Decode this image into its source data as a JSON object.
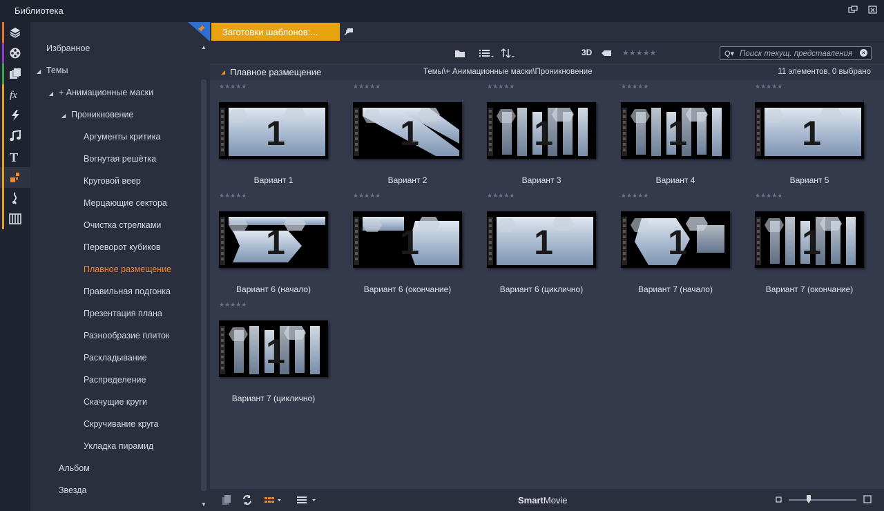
{
  "window": {
    "title": "Библиотека"
  },
  "sidebar_icons": [
    {
      "name": "project-bin-icon",
      "color": "#e8742a"
    },
    {
      "name": "film-reel-icon",
      "color": "#8a3fc9"
    },
    {
      "name": "photos-icon",
      "color": "#3aa84a"
    },
    {
      "name": "effects-fx-icon",
      "color": "#e0a020"
    },
    {
      "name": "transitions-icon",
      "color": "#e0a020"
    },
    {
      "name": "music-note-icon",
      "color": "#e0a020"
    },
    {
      "name": "titles-text-icon",
      "color": "#e0a020"
    },
    {
      "name": "montage-templates-icon",
      "color": "#e0a020"
    },
    {
      "name": "sound-effects-icon",
      "color": "#e0a020"
    },
    {
      "name": "keyboard-icon",
      "color": "#e0a020"
    }
  ],
  "tree": {
    "favorites": "Избранное",
    "themes": "Темы",
    "animated_masks": "+ Анимационные маски",
    "penetration": "Проникновение",
    "items": [
      "Аргументы критика",
      "Вогнутая решётка",
      "Круговой веер",
      "Мерцающие сектора",
      "Очистка стрелками",
      "Переворот кубиков",
      "Плавное размещение",
      "Правильная подгонка",
      "Презентация плана",
      "Разнообразие плиток",
      "Раскладывание",
      "Распределение",
      "Скачущие круги",
      "Скручивание круга",
      "Укладка пирамид"
    ],
    "selected_index": 6,
    "album": "Альбом",
    "star": "Звезда"
  },
  "tabs": {
    "active_label": "Заготовки шаблонов:..."
  },
  "toolbar": {
    "label_3d": "3D",
    "rating": "★★★★★"
  },
  "search": {
    "placeholder": "Поиск текущ. представления"
  },
  "pathbar": {
    "name": "Плавное размещение",
    "path": "Темы\\+ Анимационные маски\\Проникновение",
    "count": "11 элементов, 0 выбрано"
  },
  "thumbnails": [
    {
      "caption": "Вариант 1",
      "rating": "★★★★★"
    },
    {
      "caption": "Вариант 2",
      "rating": "★★★★★"
    },
    {
      "caption": "Вариант 3",
      "rating": "★★★★★"
    },
    {
      "caption": "Вариант 4",
      "rating": "★★★★★"
    },
    {
      "caption": "Вариант 5",
      "rating": "★★★★★"
    },
    {
      "caption": "Вариант 6 (начало)",
      "rating": "★★★★★"
    },
    {
      "caption": "Вариант 6 (окончание)",
      "rating": "★★★★★"
    },
    {
      "caption": "Вариант 6 (циклично)",
      "rating": "★★★★★"
    },
    {
      "caption": "Вариант 7 (начало)",
      "rating": "★★★★★"
    },
    {
      "caption": "Вариант 7 (окончание)",
      "rating": "★★★★★"
    },
    {
      "caption": "Вариант 7 (циклично)",
      "rating": "★★★★★"
    }
  ],
  "statusbar": {
    "brand_bold": "Smart",
    "brand_rest": "Movie",
    "zoom_level": 0.3
  },
  "colors": {
    "accent_orange": "#f08a24",
    "tab_yellow": "#e8a40e"
  }
}
